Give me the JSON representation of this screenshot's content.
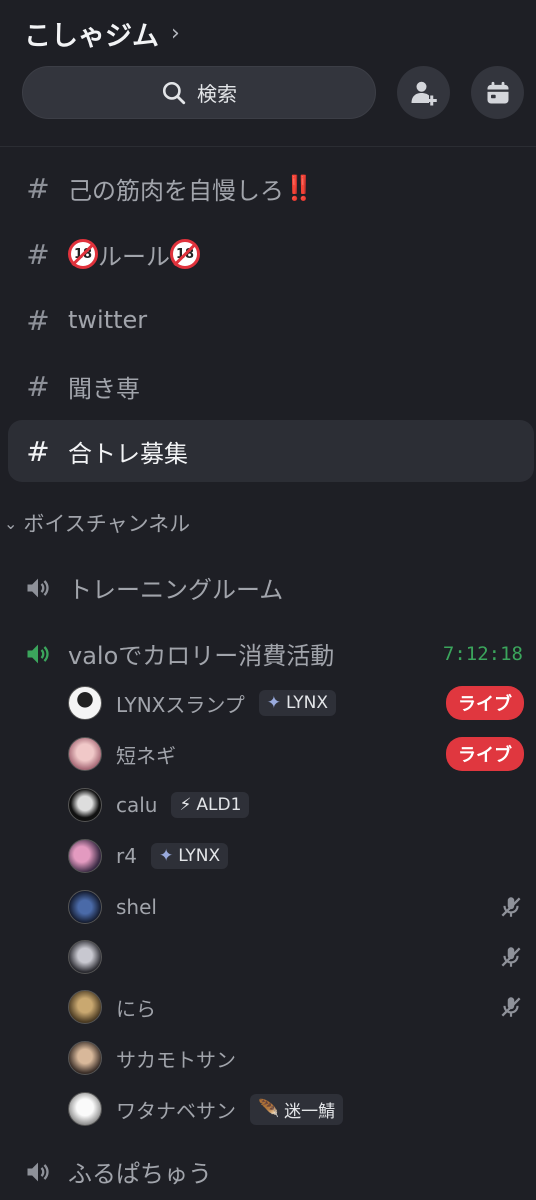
{
  "header": {
    "server_name": "こしゃジム",
    "chevron": "›"
  },
  "search": {
    "label": "検索"
  },
  "text_channels": [
    {
      "name": "己の筋肉を自慢しろ",
      "suffix": "‼️"
    },
    {
      "name": "ルール",
      "badge": "18"
    },
    {
      "name": "twitter"
    },
    {
      "name": "聞き専"
    },
    {
      "name": "合トレ募集",
      "active": true
    }
  ],
  "category": {
    "label": "ボイスチャンネル",
    "chevron": "⌄"
  },
  "voice_channels": [
    {
      "name": "トレーニングルーム"
    },
    {
      "name": "valoでカロリー消費活動",
      "timer": "7:12:18"
    },
    {
      "name": "ふるぱちゅう"
    }
  ],
  "members": [
    {
      "name": "LYNXスランプ",
      "tag": "LYNX",
      "tag_icon": "diamond-icon",
      "live": "ライブ"
    },
    {
      "name": "短ネギ",
      "live": "ライブ"
    },
    {
      "name": "calu",
      "tag": "ALD1",
      "tag_icon": "lightning-icon"
    },
    {
      "name": "r4",
      "tag": "LYNX",
      "tag_icon": "diamond-icon"
    },
    {
      "name": "shel",
      "muted": true
    },
    {
      "name": "",
      "muted": true
    },
    {
      "name": "にら",
      "muted": true
    },
    {
      "name": "サカモトサン"
    },
    {
      "name": "ワタナベサン",
      "tag": "迷一鯖",
      "tag_icon": "feather-icon"
    }
  ],
  "colors": {
    "background": "#1e1f25",
    "live": "#e0373f",
    "active_voice": "#3ba55c",
    "badge_red": "#e0323c"
  }
}
